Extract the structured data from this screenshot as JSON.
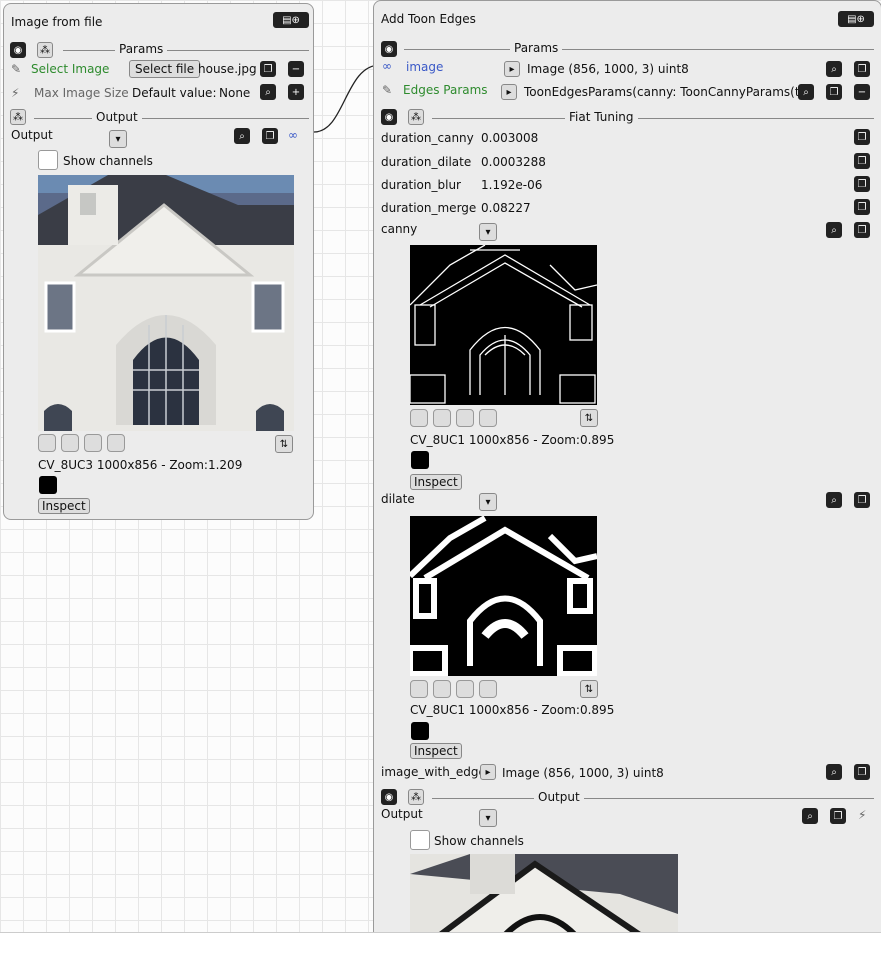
{
  "left_node": {
    "title": "Image from file",
    "params_label": "Params",
    "select_image_label": "Select Image",
    "select_file_button": "Select file",
    "file_name": "house.jpg",
    "max_image_size_label": "Max Image Size",
    "default_value_label": "Default value:",
    "default_value": "None",
    "output_section_label": "Output",
    "output_label": "Output",
    "show_channels_label": "Show channels",
    "image_info": "CV_8UC3 1000x856 - Zoom:1.209",
    "inspect_label": "Inspect"
  },
  "right_node": {
    "title": "Add Toon Edges",
    "params_label": "Params",
    "image_label": "image",
    "image_value": "Image (856, 1000, 3) uint8",
    "edges_params_label": "Edges Params",
    "edges_params_value": "ToonEdgesParams(canny: ToonCannyParams(t...",
    "fiat_tuning_label": "Fiat Tuning",
    "tuning": [
      {
        "name": "duration_canny",
        "value": "0.003008"
      },
      {
        "name": "duration_dilate",
        "value": "0.0003288"
      },
      {
        "name": "duration_blur",
        "value": "1.192e-06"
      },
      {
        "name": "duration_merge",
        "value": "0.08227"
      }
    ],
    "canny_label": "canny",
    "canny_info": "CV_8UC1 1000x856 - Zoom:0.895",
    "dilate_label": "dilate",
    "dilate_info": "CV_8UC1 1000x856 - Zoom:0.895",
    "inspect_label": "Inspect",
    "image_with_edges_label": "image_with_edge...",
    "image_with_edges_value": "Image (856, 1000, 3) uint8",
    "output_section_label": "Output",
    "output_label": "Output",
    "show_channels_label": "Show channels"
  }
}
